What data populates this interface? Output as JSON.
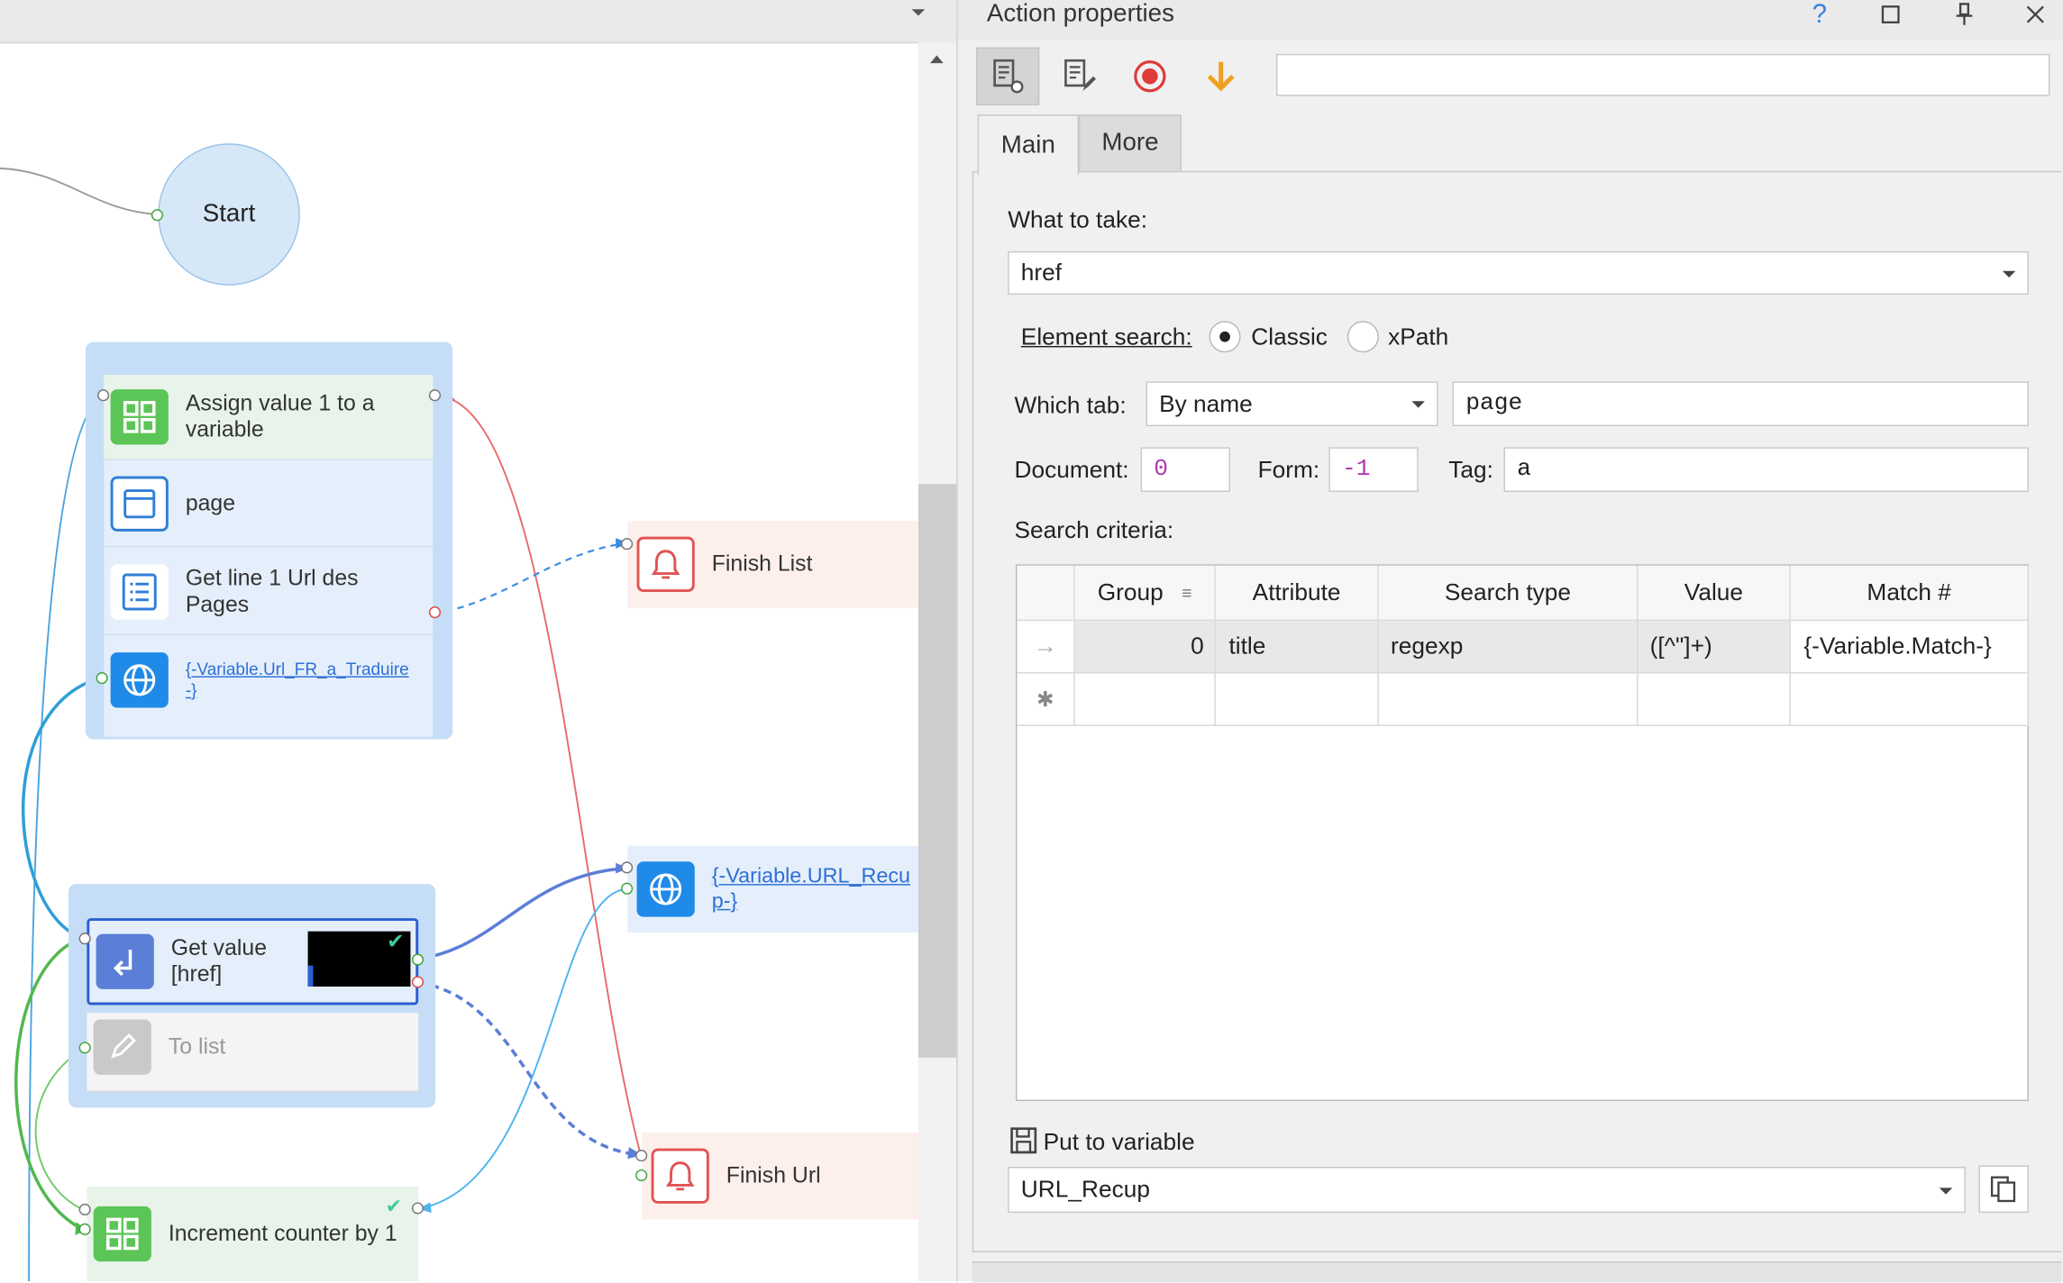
{
  "canvas": {
    "start_label": "Start",
    "group1": {
      "assign_label": "Assign value 1 to a variable",
      "page_label": "page",
      "get_line_label": "Get line 1 Url  des Pages",
      "navigate_link": "{-Variable.Url_FR_a_Traduire-}"
    },
    "finish_list_label": "Finish List",
    "group2": {
      "get_value_label": "Get value [href]",
      "to_list_label": "To list"
    },
    "url_recup_link": "{-Variable.URL_Recup-}",
    "finish_url_label": "Finish Url",
    "increment_label": "Increment counter by 1"
  },
  "panel": {
    "title": "Action properties",
    "help_icon": "?",
    "tabs": {
      "main": "Main",
      "more": "More"
    },
    "toolbar_input_value": "",
    "what_to_take_label": "What to take:",
    "what_to_take_value": "href",
    "element_search_label": "Element search:",
    "search_mode_classic": "Classic",
    "search_mode_xpath": "xPath",
    "search_mode_selected": "Classic",
    "which_tab_label": "Which tab:",
    "which_tab_mode": "By name",
    "which_tab_value": "page",
    "document_label": "Document:",
    "document_value": "0",
    "form_label": "Form:",
    "form_value": "-1",
    "tag_label": "Tag:",
    "tag_value": "a",
    "search_criteria_label": "Search criteria:",
    "grid": {
      "headers": [
        "Group",
        "Attribute",
        "Search type",
        "Value",
        "Match #"
      ],
      "rows": [
        [
          "0",
          "title",
          "regexp",
          "([^\"]+)",
          "{-Variable.Match-}"
        ]
      ]
    },
    "put_to_variable_label": "Put to variable",
    "put_to_variable_value": "URL_Recup"
  },
  "colors": {
    "node_green": "#5cc557",
    "node_blue": "#1f8ae8",
    "group_bg": "#c6ddf7",
    "error_red": "#e05454",
    "accent_blue": "#2f7fd6"
  }
}
